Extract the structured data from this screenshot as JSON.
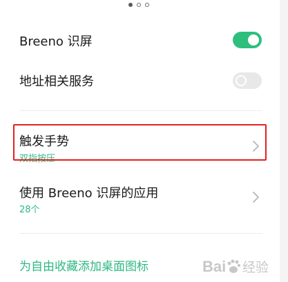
{
  "pagination": {
    "total": 3,
    "active_index": 0
  },
  "settings": {
    "breeno_screen": {
      "label": "Breeno 识屏",
      "enabled": true
    },
    "address_service": {
      "label": "地址相关服务",
      "enabled": false
    },
    "trigger_gesture": {
      "label": "触发手势",
      "value": "双指按压"
    },
    "apps_using_breeno": {
      "label": "使用 Breeno 识屏的应用",
      "value": "28个"
    }
  },
  "add_favorites_link": "为自由收藏添加桌面图标",
  "colors": {
    "accent_green": "#2fbf7d",
    "highlight_red": "#e02020"
  },
  "watermark": {
    "text": "Bai 经验",
    "icon": "baidu-paw-icon"
  }
}
